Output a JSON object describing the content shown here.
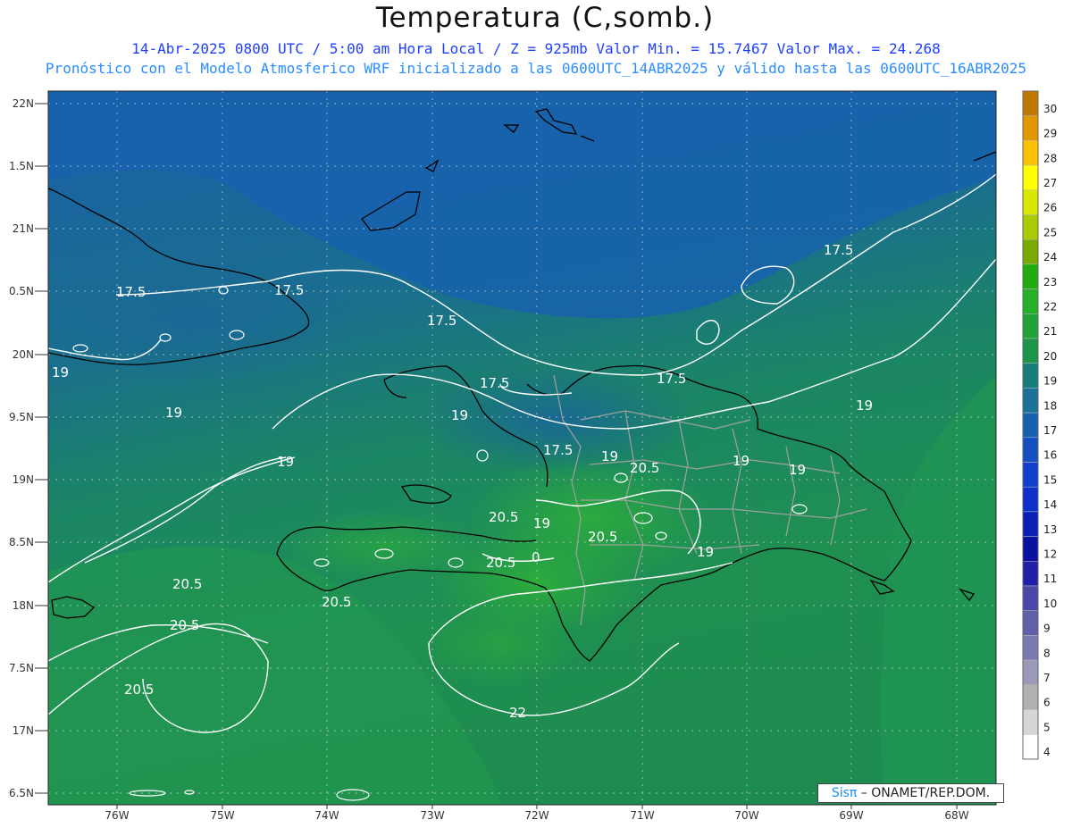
{
  "header": {
    "title": "Temperatura (C,somb.)",
    "line1": "14-Abr-2025  0800 UTC / 5:00 am Hora Local / Z = 925mb    Valor Min. = 15.7467  Valor Max. = 24.268",
    "line2": "Pronóstico con el Modelo Atmosferico WRF inicializado a las 0600UTC_14ABR2025 y válido hasta las  0600UTC_16ABR2025"
  },
  "axes": {
    "lon_labels": [
      "76W",
      "75W",
      "74W",
      "73W",
      "72W",
      "71W",
      "70W",
      "69W",
      "68W"
    ],
    "lat_labels": [
      "22N",
      "1.5N",
      "21N",
      "0.5N",
      "20N",
      "9.5N",
      "19N",
      "8.5N",
      "18N",
      "7.5N",
      "17N",
      "6.5N"
    ]
  },
  "colorbar": {
    "labels": [
      "30",
      "29",
      "28",
      "27",
      "26",
      "25",
      "24",
      "23",
      "22",
      "21",
      "20",
      "19",
      "18",
      "17",
      "16",
      "15",
      "14",
      "13",
      "12",
      "11",
      "10",
      "9",
      "8",
      "7",
      "6",
      "5",
      "4"
    ],
    "colors": [
      "#c07800",
      "#e09800",
      "#ffc000",
      "#ffff00",
      "#d8e800",
      "#a8cc00",
      "#78aa00",
      "#22aa11",
      "#26b02a",
      "#23a23a",
      "#1e944a",
      "#167e78",
      "#1a7298",
      "#1860b0",
      "#1450c0",
      "#1040d0",
      "#0c30c8",
      "#0820b8",
      "#0a10a0",
      "#2020a8",
      "#4848a8",
      "#6060a8",
      "#7a7ab0",
      "#9a9ab8",
      "#b0b0b0",
      "#d6d6d6",
      "#ffffff"
    ]
  },
  "contours": {
    "labels": [
      "17.5",
      "17.5",
      "17.5",
      "17.5",
      "17.5",
      "17.5",
      "17.5",
      "19",
      "19",
      "19",
      "19",
      "19",
      "19",
      "19",
      "19",
      "19",
      "19",
      "20.5",
      "20.5",
      "20.5",
      "20.5",
      "20.5",
      "20.5",
      "20.5",
      "20.5",
      "22",
      "0"
    ]
  },
  "credit": {
    "brand": "Sisπ",
    "text": " – ONAMET/REP.DOM."
  },
  "colors": {
    "ocean_deep": "#1a62a8",
    "ocean_mid": "#1a7288",
    "sea_warm": "#1f8f50",
    "land_warm": "#2aa838",
    "contour": "#ffffff",
    "coast": "#000000",
    "provinces": "#9a9a9a"
  }
}
